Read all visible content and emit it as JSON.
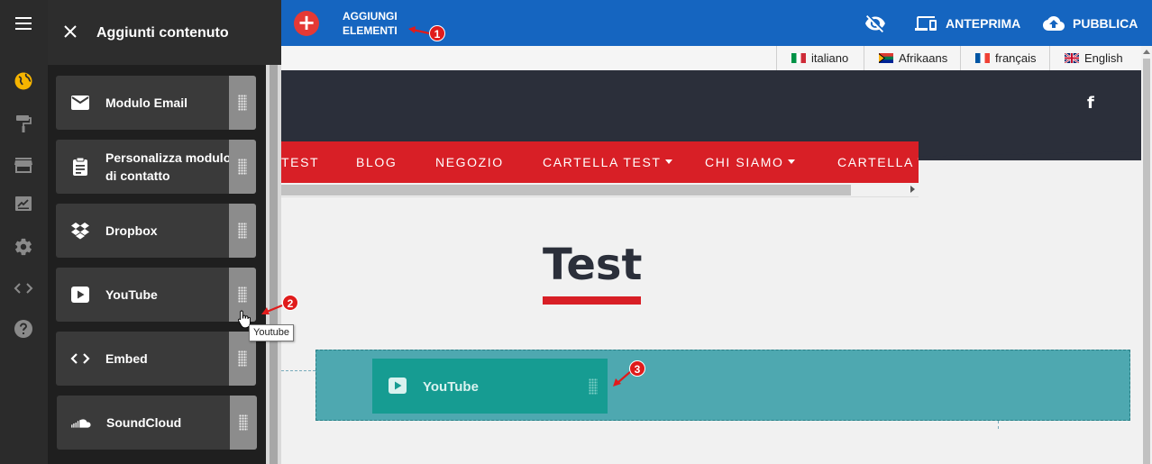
{
  "toolbar": {
    "add_label": "AGGIUNGI\nELEMENTI",
    "preview_label": "ANTEPRIMA",
    "publish_label": "PUBBLICA"
  },
  "languages": [
    {
      "label": "italiano",
      "flag": "it"
    },
    {
      "label": "Afrikaans",
      "flag": "za"
    },
    {
      "label": "français",
      "flag": "fr"
    },
    {
      "label": "English",
      "flag": "gb"
    }
  ],
  "site": {
    "social_icon": "f",
    "nav": [
      "TEST",
      "BLOG",
      "NEGOZIO",
      "CARTELLA TEST",
      "CHI SIAMO",
      "CARTELLA TEST"
    ],
    "page_title": "Test"
  },
  "panel": {
    "title": "Aggiunti contenuto",
    "blocks": [
      {
        "label": "Modulo Email",
        "icon": "email-icon"
      },
      {
        "label": "Personalizza modulo di contatto",
        "icon": "clipboard-icon"
      },
      {
        "label": "Dropbox",
        "icon": "dropbox-icon"
      },
      {
        "label": "YouTube",
        "icon": "youtube-icon"
      },
      {
        "label": "Embed",
        "icon": "code-icon"
      },
      {
        "label": "SoundCloud",
        "icon": "soundcloud-icon"
      }
    ]
  },
  "drag_preview": {
    "label": "YouTube"
  },
  "tooltip": "Youtube",
  "callouts": [
    "1",
    "2",
    "3"
  ],
  "colors": {
    "topbar": "#1565c0",
    "add_button": "#e53935",
    "nav": "#d81f26",
    "header": "#2b2f3a",
    "dropzone": "#4ea8b0",
    "drag_preview": "#169c92"
  }
}
